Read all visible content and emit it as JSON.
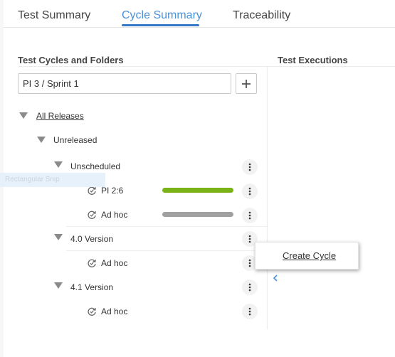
{
  "tabs": [
    {
      "label": "Test Summary"
    },
    {
      "label": "Cycle Summary"
    },
    {
      "label": "Traceability"
    }
  ],
  "left_panel": {
    "title": "Test Cycles and Folders",
    "search_value": "PI 3 / Sprint 1",
    "add_icon": "plus-icon"
  },
  "right_panel": {
    "title": "Test Executions"
  },
  "tree": {
    "root": "All Releases",
    "unreleased": "Unreleased",
    "unscheduled": {
      "label": "Unscheduled",
      "cycles": [
        {
          "label": "PI 2:6",
          "progress_color": "#7ab317",
          "progress": 1.0
        },
        {
          "label": "Ad hoc",
          "progress_color": "#a0a0a0",
          "progress": 1.0
        }
      ]
    },
    "v40": {
      "label": "4.0 Version",
      "cycles": [
        {
          "label": "Ad hoc"
        }
      ]
    },
    "v41": {
      "label": "4.1 Version",
      "cycles": [
        {
          "label": "Ad hoc"
        }
      ]
    }
  },
  "context_menu": {
    "create_cycle": "Create Cycle"
  },
  "overlay": {
    "snip_label": "Rectangular Snip"
  },
  "colors": {
    "accent": "#4a90d9",
    "underline": "#3578c7"
  }
}
